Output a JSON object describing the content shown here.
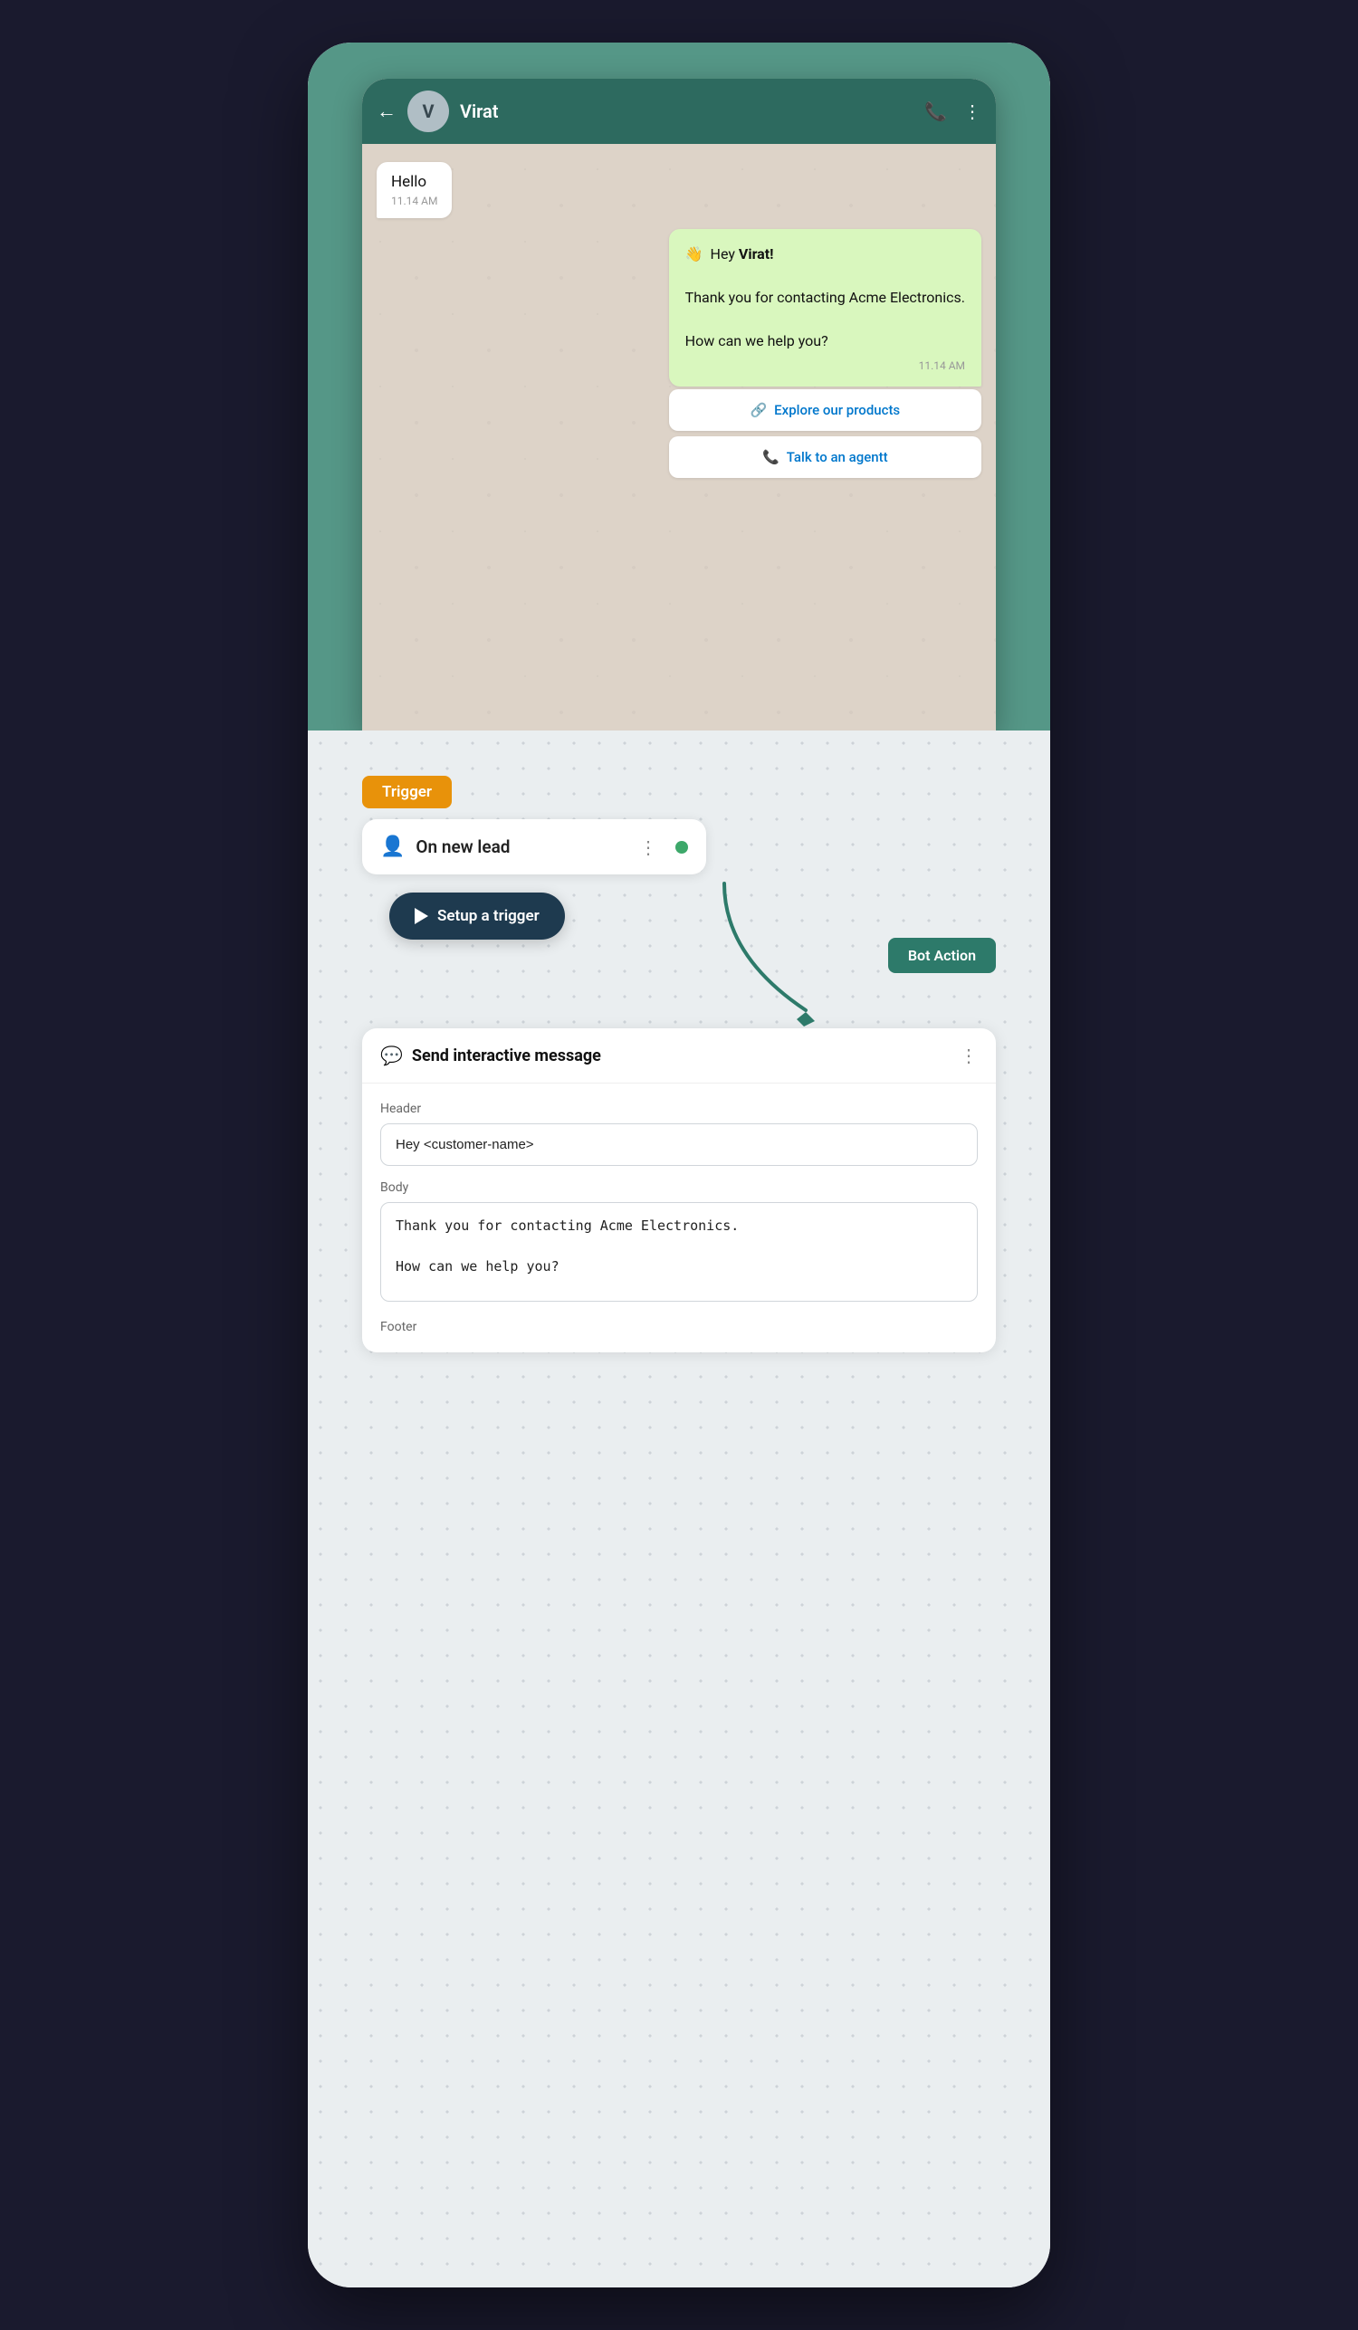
{
  "whatsapp": {
    "header": {
      "back_label": "←",
      "avatar_letter": "V",
      "contact_name": "Virat",
      "phone_icon": "📞",
      "menu_icon": "⋮"
    },
    "messages": [
      {
        "type": "received",
        "text": "Hello",
        "time": "11.14 AM"
      },
      {
        "type": "sent",
        "greeting": "👋  Hey ",
        "greeting_name": "Virat!",
        "body": "Thank you for contacting Acme Electronics.\n\nHow can we help you?",
        "time": "11.14 AM"
      }
    ],
    "buttons": [
      {
        "icon": "🔗",
        "label": "Explore our products"
      },
      {
        "icon": "📞",
        "label": "Talk to an agentt"
      }
    ]
  },
  "automation": {
    "trigger_badge": "Trigger",
    "trigger_card": {
      "icon": "👤",
      "label": "On new lead",
      "dots": "⋮"
    },
    "setup_trigger": {
      "label": "Setup a trigger"
    },
    "bot_action_badge": "Bot Action",
    "bot_action_card": {
      "icon": "💬",
      "title": "Send interactive message",
      "dots": "⋮",
      "fields": {
        "header_label": "Header",
        "header_value": "Hey <customer-name>",
        "body_label": "Body",
        "body_value": "Thank you for contacting Acme Electronics.\n\nHow can we help you?",
        "footer_label": "Footer"
      }
    }
  }
}
